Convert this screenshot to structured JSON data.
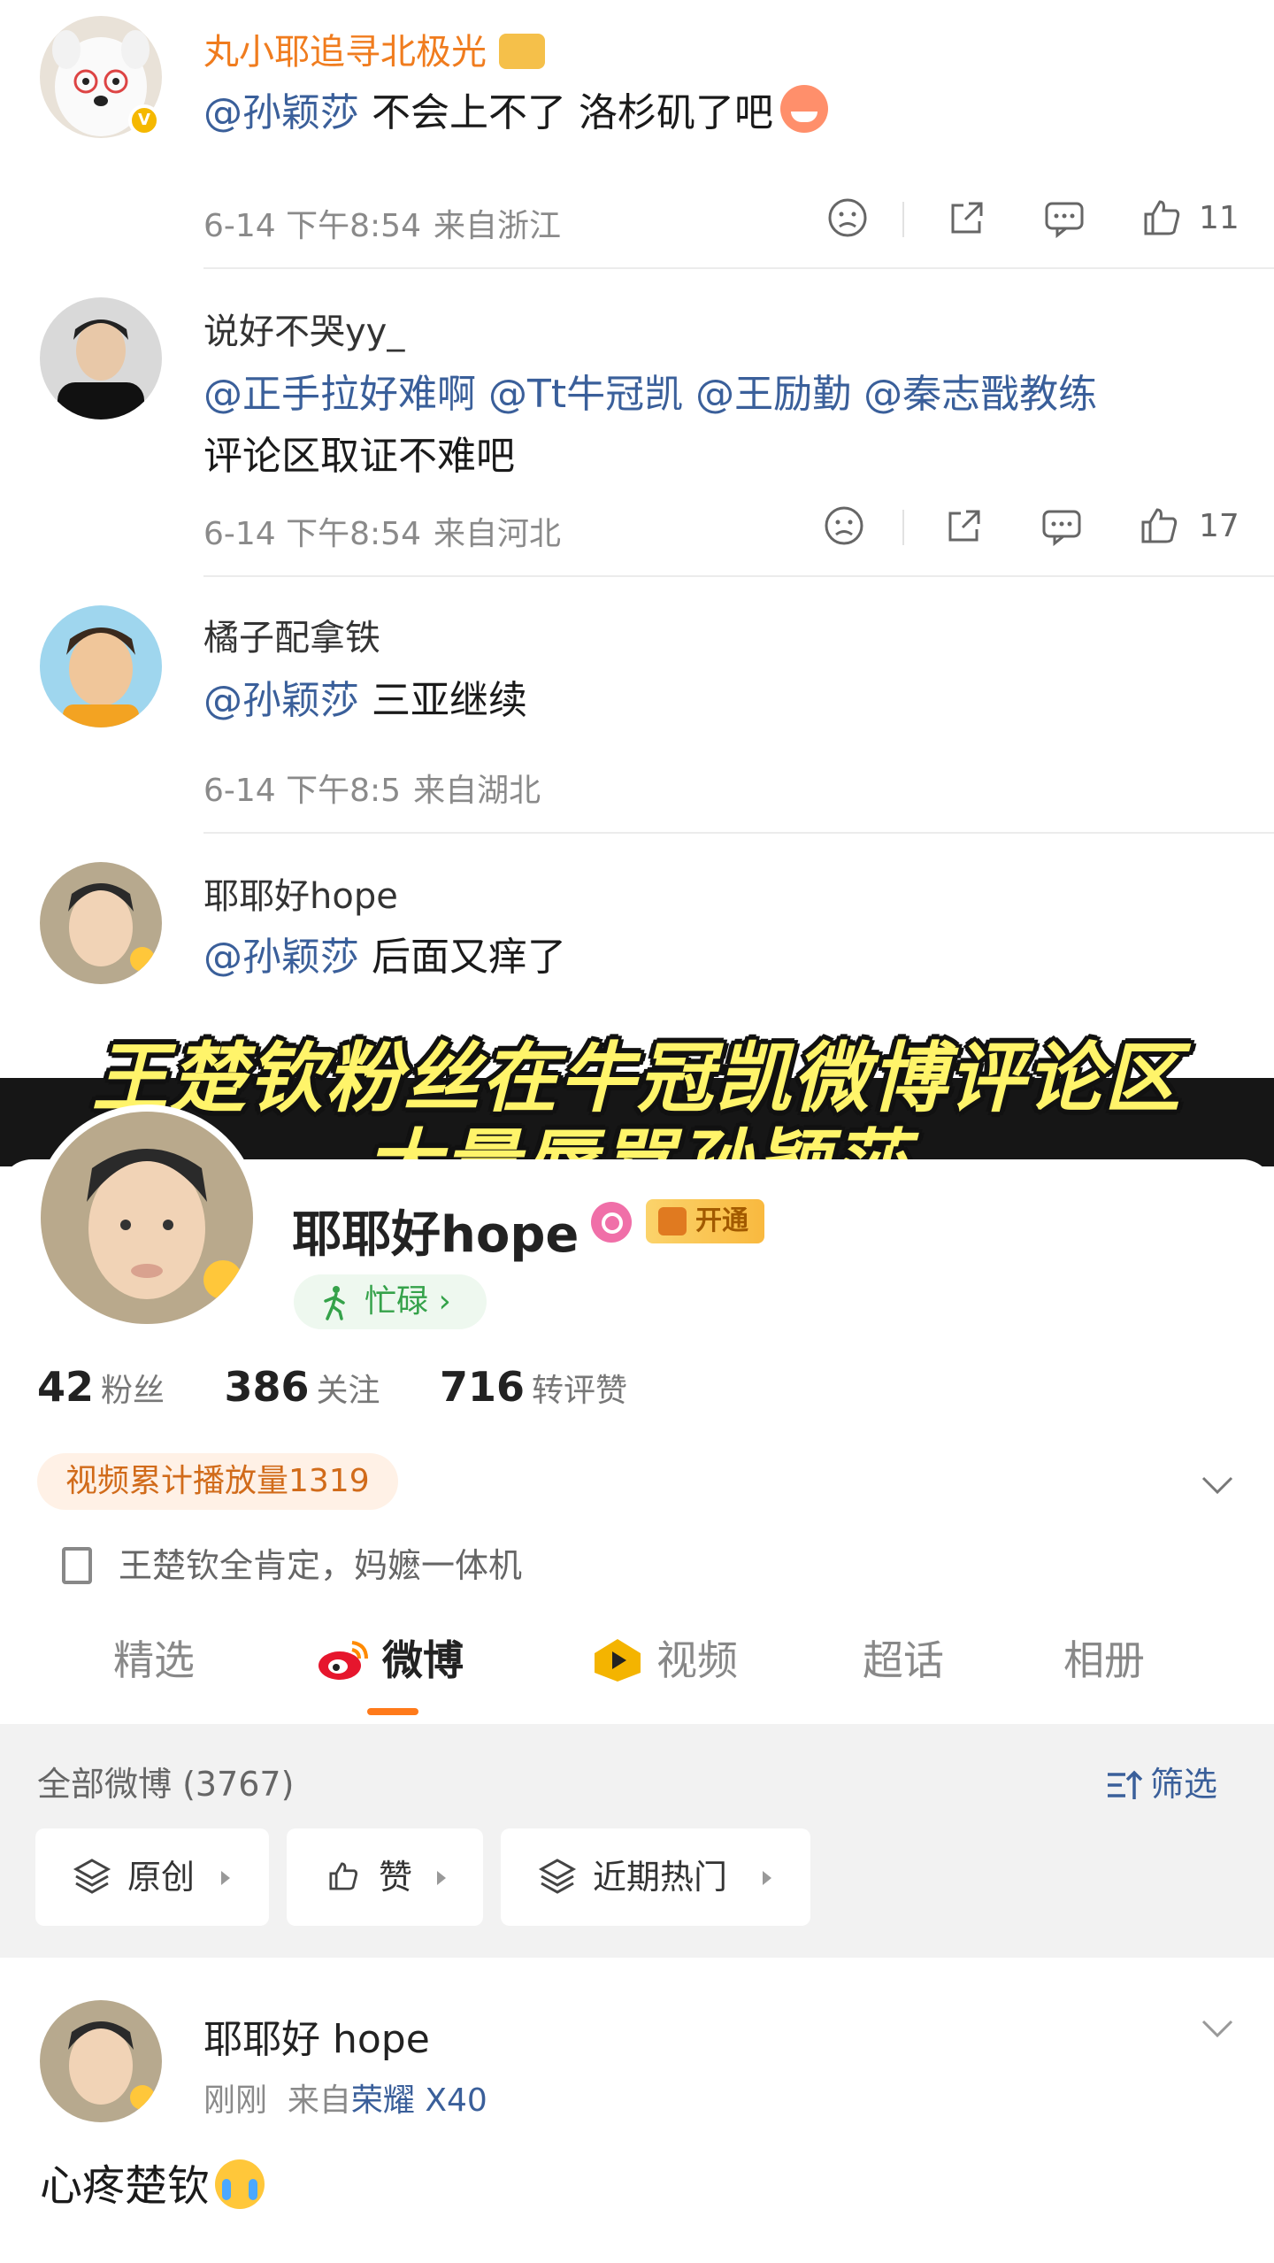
{
  "comments": [
    {
      "name": "丸小耶追寻北极光",
      "text_mention": "@孙颖莎",
      "text_body": " 不会上不了 洛杉矶了吧",
      "time": "6-14 下午8:54",
      "location": "来自浙江",
      "likes": "11"
    },
    {
      "name": "说好不哭yy_",
      "line1_mentions": "@正手拉好难啊 @Tt牛冠凯 @王励勤 @秦志戬教练",
      "line2": "评论区取证不难吧",
      "time": "6-14 下午8:54",
      "location": "来自河北",
      "likes": "17"
    },
    {
      "name": "橘子配拿铁",
      "text_mention": "@孙颖莎",
      "text_body": " 三亚继续",
      "time": "6-14 下午8:5",
      "location": "来自湖北"
    },
    {
      "name": "耶耶好hope",
      "text_mention": "@孙颖莎",
      "text_body": " 后面又痒了"
    }
  ],
  "caption": {
    "line1": "王楚钦粉丝在牛冠凯微博评论区",
    "line2": "大量辱骂孙颖莎"
  },
  "profile": {
    "name": "耶耶好hope",
    "open_label": "开通",
    "status": "忙碌 ›",
    "stats": [
      {
        "num": "42",
        "label": "粉丝"
      },
      {
        "num": "386",
        "label": "关注"
      },
      {
        "num": "716",
        "label": "转评赞"
      }
    ],
    "play_count": "视频累计播放量1319",
    "bio": "王楚钦全肯定，妈嬷一体机"
  },
  "tabs": [
    "精选",
    "微博",
    "视频",
    "超话",
    "相册"
  ],
  "filter": {
    "all": "全部微博 (3767)",
    "filter_label": "筛选",
    "buttons": [
      "原创",
      "赞",
      "近期热门"
    ]
  },
  "post": {
    "name": "耶耶好 hope",
    "time": "刚刚",
    "source_prefix": "来自",
    "device": "荣耀 X40",
    "text": "心疼楚钦"
  },
  "colors": {
    "mention": "#3a5f9a",
    "orange_name": "#f07c1e",
    "caption": "#fff46a",
    "tab_underline": "#ff7a1a"
  }
}
